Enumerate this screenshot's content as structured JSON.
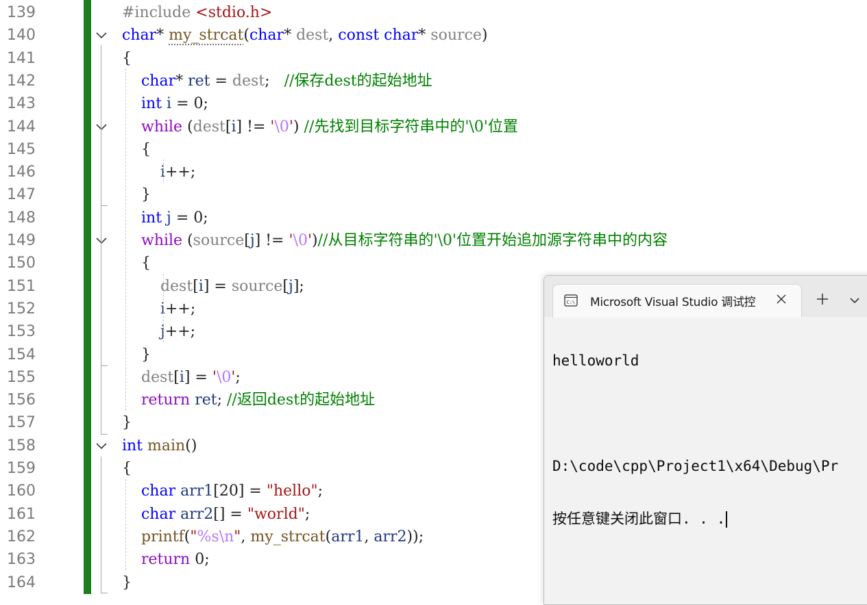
{
  "lines": [
    {
      "num": "139",
      "tokens": [
        {
          "t": "#include ",
          "c": "pre"
        },
        {
          "t": "<stdio.h>",
          "c": "str"
        }
      ]
    },
    {
      "num": "140",
      "tokens": [
        {
          "t": "char",
          "c": "kw"
        },
        {
          "t": "* ",
          "c": "op"
        },
        {
          "t": "my_strcat",
          "c": "fn"
        },
        {
          "t": "(",
          "c": "op"
        },
        {
          "t": "char",
          "c": "kw"
        },
        {
          "t": "* ",
          "c": "op"
        },
        {
          "t": "dest",
          "c": "par"
        },
        {
          "t": ", ",
          "c": "op"
        },
        {
          "t": "const",
          "c": "kw"
        },
        {
          "t": " ",
          "c": "op"
        },
        {
          "t": "char",
          "c": "kw"
        },
        {
          "t": "* ",
          "c": "op"
        },
        {
          "t": "source",
          "c": "par"
        },
        {
          "t": ")",
          "c": "op"
        }
      ]
    },
    {
      "num": "141",
      "tokens": [
        {
          "t": "{",
          "c": "op"
        }
      ]
    },
    {
      "num": "142",
      "tokens": [
        {
          "t": "    ",
          "c": "op"
        },
        {
          "t": "char",
          "c": "kw"
        },
        {
          "t": "* ",
          "c": "op"
        },
        {
          "t": "ret",
          "c": "loc"
        },
        {
          "t": " = ",
          "c": "op"
        },
        {
          "t": "dest",
          "c": "par"
        },
        {
          "t": ";   ",
          "c": "op"
        },
        {
          "t": "//保存dest的起始地址",
          "c": "cmt"
        }
      ]
    },
    {
      "num": "143",
      "tokens": [
        {
          "t": "    ",
          "c": "op"
        },
        {
          "t": "int",
          "c": "kw"
        },
        {
          "t": " ",
          "c": "op"
        },
        {
          "t": "i",
          "c": "loc"
        },
        {
          "t": " = ",
          "c": "op"
        },
        {
          "t": "0",
          "c": "op"
        },
        {
          "t": ";",
          "c": "op"
        }
      ]
    },
    {
      "num": "144",
      "tokens": [
        {
          "t": "    ",
          "c": "op"
        },
        {
          "t": "while",
          "c": "ctl"
        },
        {
          "t": " (",
          "c": "op"
        },
        {
          "t": "dest",
          "c": "par"
        },
        {
          "t": "[",
          "c": "op"
        },
        {
          "t": "i",
          "c": "loc"
        },
        {
          "t": "] != ",
          "c": "op"
        },
        {
          "t": "'",
          "c": "str"
        },
        {
          "t": "\\0",
          "c": "esc"
        },
        {
          "t": "'",
          "c": "str"
        },
        {
          "t": ") ",
          "c": "op"
        },
        {
          "t": "//先找到目标字符串中的'\\0'位置",
          "c": "cmt"
        }
      ]
    },
    {
      "num": "145",
      "tokens": [
        {
          "t": "    {",
          "c": "op"
        }
      ]
    },
    {
      "num": "146",
      "tokens": [
        {
          "t": "        ",
          "c": "op"
        },
        {
          "t": "i",
          "c": "loc"
        },
        {
          "t": "++;",
          "c": "op"
        }
      ]
    },
    {
      "num": "147",
      "tokens": [
        {
          "t": "    }",
          "c": "op"
        }
      ]
    },
    {
      "num": "148",
      "tokens": [
        {
          "t": "    ",
          "c": "op"
        },
        {
          "t": "int",
          "c": "kw"
        },
        {
          "t": " ",
          "c": "op"
        },
        {
          "t": "j",
          "c": "loc"
        },
        {
          "t": " = ",
          "c": "op"
        },
        {
          "t": "0",
          "c": "op"
        },
        {
          "t": ";",
          "c": "op"
        }
      ]
    },
    {
      "num": "149",
      "tokens": [
        {
          "t": "    ",
          "c": "op"
        },
        {
          "t": "while",
          "c": "ctl"
        },
        {
          "t": " (",
          "c": "op"
        },
        {
          "t": "source",
          "c": "par"
        },
        {
          "t": "[",
          "c": "op"
        },
        {
          "t": "j",
          "c": "loc"
        },
        {
          "t": "] != ",
          "c": "op"
        },
        {
          "t": "'",
          "c": "str"
        },
        {
          "t": "\\0",
          "c": "esc"
        },
        {
          "t": "'",
          "c": "str"
        },
        {
          "t": ")",
          "c": "op"
        },
        {
          "t": "//从目标字符串的'\\0'位置开始追加源字符串中的内容",
          "c": "cmt"
        }
      ]
    },
    {
      "num": "150",
      "tokens": [
        {
          "t": "    {",
          "c": "op"
        }
      ]
    },
    {
      "num": "151",
      "tokens": [
        {
          "t": "        ",
          "c": "op"
        },
        {
          "t": "dest",
          "c": "par"
        },
        {
          "t": "[",
          "c": "op"
        },
        {
          "t": "i",
          "c": "loc"
        },
        {
          "t": "] = ",
          "c": "op"
        },
        {
          "t": "source",
          "c": "par"
        },
        {
          "t": "[",
          "c": "op"
        },
        {
          "t": "j",
          "c": "loc"
        },
        {
          "t": "];",
          "c": "op"
        }
      ]
    },
    {
      "num": "152",
      "tokens": [
        {
          "t": "        ",
          "c": "op"
        },
        {
          "t": "i",
          "c": "loc"
        },
        {
          "t": "++;",
          "c": "op"
        }
      ]
    },
    {
      "num": "153",
      "tokens": [
        {
          "t": "        ",
          "c": "op"
        },
        {
          "t": "j",
          "c": "loc"
        },
        {
          "t": "++;",
          "c": "op"
        }
      ]
    },
    {
      "num": "154",
      "tokens": [
        {
          "t": "    }",
          "c": "op"
        }
      ]
    },
    {
      "num": "155",
      "tokens": [
        {
          "t": "    ",
          "c": "op"
        },
        {
          "t": "dest",
          "c": "par"
        },
        {
          "t": "[",
          "c": "op"
        },
        {
          "t": "i",
          "c": "loc"
        },
        {
          "t": "] = ",
          "c": "op"
        },
        {
          "t": "'",
          "c": "str"
        },
        {
          "t": "\\0",
          "c": "esc"
        },
        {
          "t": "'",
          "c": "str"
        },
        {
          "t": ";",
          "c": "op"
        }
      ]
    },
    {
      "num": "156",
      "tokens": [
        {
          "t": "    ",
          "c": "op"
        },
        {
          "t": "return",
          "c": "ctl"
        },
        {
          "t": " ",
          "c": "op"
        },
        {
          "t": "ret",
          "c": "loc"
        },
        {
          "t": "; ",
          "c": "op"
        },
        {
          "t": "//返回dest的起始地址",
          "c": "cmt"
        }
      ]
    },
    {
      "num": "157",
      "tokens": [
        {
          "t": "}",
          "c": "op"
        }
      ]
    },
    {
      "num": "158",
      "tokens": [
        {
          "t": "int",
          "c": "kw"
        },
        {
          "t": " ",
          "c": "op"
        },
        {
          "t": "main",
          "c": "fn"
        },
        {
          "t": "()",
          "c": "op"
        }
      ]
    },
    {
      "num": "159",
      "tokens": [
        {
          "t": "{",
          "c": "op"
        }
      ]
    },
    {
      "num": "160",
      "tokens": [
        {
          "t": "    ",
          "c": "op"
        },
        {
          "t": "char",
          "c": "kw"
        },
        {
          "t": " ",
          "c": "op"
        },
        {
          "t": "arr1",
          "c": "loc"
        },
        {
          "t": "[",
          "c": "op"
        },
        {
          "t": "20",
          "c": "op"
        },
        {
          "t": "] = ",
          "c": "op"
        },
        {
          "t": "\"hello\"",
          "c": "str"
        },
        {
          "t": ";",
          "c": "op"
        }
      ]
    },
    {
      "num": "161",
      "tokens": [
        {
          "t": "    ",
          "c": "op"
        },
        {
          "t": "char",
          "c": "kw"
        },
        {
          "t": " ",
          "c": "op"
        },
        {
          "t": "arr2",
          "c": "loc"
        },
        {
          "t": "[] = ",
          "c": "op"
        },
        {
          "t": "\"world\"",
          "c": "str"
        },
        {
          "t": ";",
          "c": "op"
        }
      ]
    },
    {
      "num": "162",
      "tokens": [
        {
          "t": "    ",
          "c": "op"
        },
        {
          "t": "printf",
          "c": "fn"
        },
        {
          "t": "(",
          "c": "op"
        },
        {
          "t": "\"",
          "c": "str"
        },
        {
          "t": "%s",
          "c": "esc"
        },
        {
          "t": "\\n",
          "c": "esc"
        },
        {
          "t": "\"",
          "c": "str"
        },
        {
          "t": ", ",
          "c": "op"
        },
        {
          "t": "my_strcat",
          "c": "fn"
        },
        {
          "t": "(",
          "c": "op"
        },
        {
          "t": "arr1",
          "c": "loc"
        },
        {
          "t": ", ",
          "c": "op"
        },
        {
          "t": "arr2",
          "c": "loc"
        },
        {
          "t": "));",
          "c": "op"
        }
      ]
    },
    {
      "num": "163",
      "tokens": [
        {
          "t": "    ",
          "c": "op"
        },
        {
          "t": "return",
          "c": "ctl"
        },
        {
          "t": " ",
          "c": "op"
        },
        {
          "t": "0",
          "c": "op"
        },
        {
          "t": ";",
          "c": "op"
        }
      ]
    },
    {
      "num": "164",
      "tokens": [
        {
          "t": "}",
          "c": "op"
        }
      ]
    }
  ],
  "fold_lines": [
    "140",
    "144",
    "149",
    "158"
  ],
  "console": {
    "icon": "console-icon",
    "icon_label": "C:\\",
    "tab_title": "Microsoft Visual Studio 调试控",
    "close_icon": "close-icon",
    "new_tab_icon": "plus-icon",
    "menu_icon": "chevron-down-icon",
    "output": [
      "helloworld",
      "",
      "D:\\code\\cpp\\Project1\\x64\\Debug\\Pr",
      "按任意键关闭此窗口. . ."
    ]
  },
  "colors": {
    "keyword": "#0000ff",
    "control": "#8f08c4",
    "comment": "#008000",
    "string": "#a31515",
    "change_bar": "#1e7e1e"
  }
}
